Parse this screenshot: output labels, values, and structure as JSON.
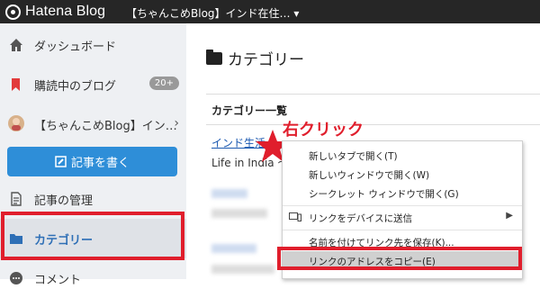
{
  "topbar": {
    "logo_text": "Hatena Blog",
    "blog_name": "【ちゃんこめBlog】インド在住… ▾"
  },
  "sidebar": {
    "items": [
      {
        "label": "ダッシュボード",
        "icon": "home-icon"
      },
      {
        "label": "購読中のブログ",
        "icon": "bookmark-icon",
        "badge": "20+"
      },
      {
        "label": "【ちゃんこめBlog】イン…",
        "icon": "avatar"
      },
      {
        "label": "記事の管理",
        "icon": "document-icon"
      },
      {
        "label": "カテゴリー",
        "icon": "folder-icon"
      },
      {
        "label": "コメント",
        "icon": "comment-icon"
      }
    ],
    "write_button": "記事を書く",
    "chevron": "›"
  },
  "main": {
    "page_title": "カテゴリー",
    "section_title": "カテゴリー一覧",
    "link1": "インド生活",
    "desc1": "Life in India ～"
  },
  "callout": "右クリック",
  "context_menu": {
    "items": [
      {
        "label": "新しいタブで開く(T)"
      },
      {
        "label": "新しいウィンドウで開く(W)"
      },
      {
        "label": "シークレット ウィンドウで開く(G)"
      },
      {
        "label": "リンクをデバイスに送信",
        "icon": "devices-icon",
        "arrow": "▶"
      },
      {
        "label": "名前を付けてリンク先を保存(K)..."
      },
      {
        "label": "リンクのアドレスをコピー(E)"
      }
    ]
  },
  "colors": {
    "accent_red": "#e01e2c",
    "primary_blue": "#2e8ed8",
    "topbar": "#262626"
  }
}
